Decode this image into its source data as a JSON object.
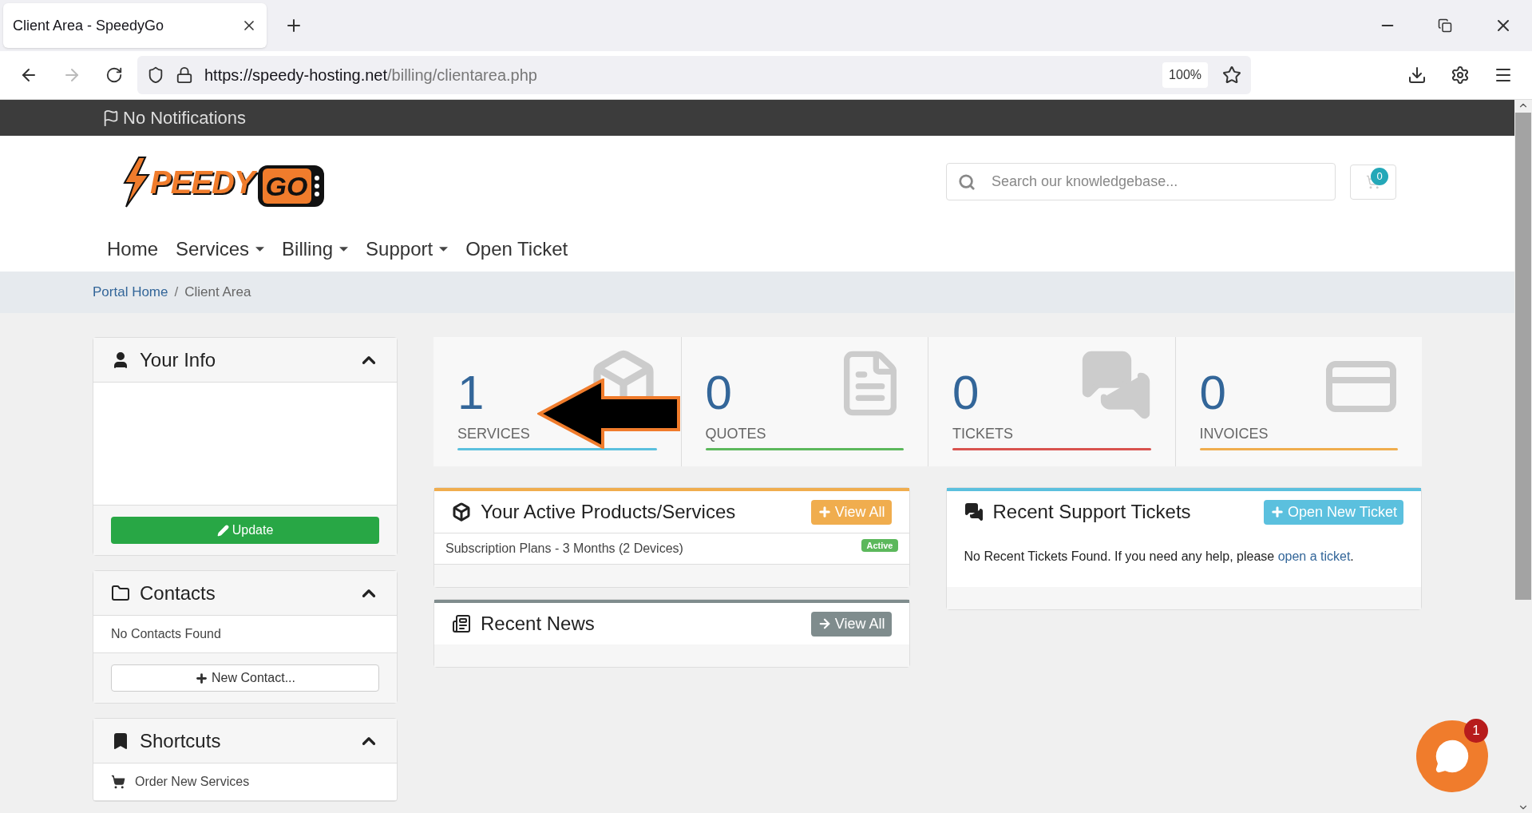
{
  "browser": {
    "tab_title": "Client Area - SpeedyGo",
    "url_host": "https://speedy-hosting.net",
    "url_path": "/billing/clientarea.php",
    "zoom": "100%"
  },
  "notifications": "No Notifications",
  "logo": {
    "word1": "PEEDY",
    "word2": "GO"
  },
  "search": {
    "placeholder": "Search our knowledgebase..."
  },
  "cart": {
    "count": "0"
  },
  "nav": [
    {
      "label": "Home",
      "dropdown": false
    },
    {
      "label": "Services",
      "dropdown": true
    },
    {
      "label": "Billing",
      "dropdown": true
    },
    {
      "label": "Support",
      "dropdown": true
    },
    {
      "label": "Open Ticket",
      "dropdown": false
    }
  ],
  "breadcrumb": [
    {
      "label": "Portal Home",
      "kind": "link"
    },
    {
      "label": "/",
      "kind": "separator"
    },
    {
      "label": "Client Area",
      "kind": "current"
    }
  ],
  "sidebar": [
    {
      "title": "Your Info",
      "expanded": true,
      "kind": "info",
      "button": "Update"
    },
    {
      "title": "Contacts",
      "expanded": true,
      "kind": "contacts",
      "rows": [
        "No Contacts Found"
      ],
      "button": "New Contact..."
    },
    {
      "title": "Shortcuts",
      "expanded": true,
      "kind": "shortcuts",
      "rows": [
        "Order New Services"
      ]
    }
  ],
  "stats": [
    {
      "value": "1",
      "label": "SERVICES",
      "color": "#5bc0de"
    },
    {
      "value": "0",
      "label": "QUOTES",
      "color": "#5cb85c"
    },
    {
      "value": "0",
      "label": "TICKETS",
      "color": "#d9534f"
    },
    {
      "value": "0",
      "label": "INVOICES",
      "color": "#f0ad4e"
    }
  ],
  "panels": {
    "products": {
      "title": "Your Active Products/Services",
      "button": "View All",
      "color": "#f0ad4e",
      "rows": [
        {
          "name": "Subscription Plans - 3 Months (2 Devices)",
          "status": "Active"
        }
      ]
    },
    "news": {
      "title": "Recent News",
      "button": "View All",
      "color": "#7f8c8d"
    },
    "tickets": {
      "title": "Recent Support Tickets",
      "button": "Open New Ticket",
      "color": "#5bc0de",
      "text": "No Recent Tickets Found. If you need any help, please ",
      "link": "open a ticket",
      "after": "."
    }
  },
  "chat": {
    "unread": "1"
  }
}
